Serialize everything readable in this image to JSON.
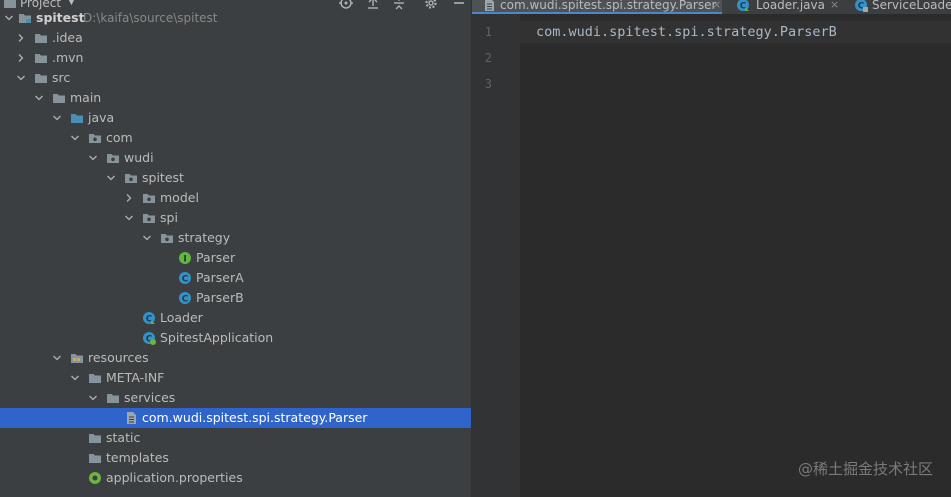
{
  "project_panel": {
    "title": "Project",
    "tree": [
      {
        "label": "spitest",
        "hint": "D:\\kaifa\\source\\spitest",
        "icon": "module-folder-icon",
        "bold": true,
        "expanded": true
      },
      {
        "label": ".idea",
        "icon": "folder-icon",
        "expanded": false
      },
      {
        "label": ".mvn",
        "icon": "folder-icon",
        "expanded": false
      },
      {
        "label": "src",
        "icon": "folder-icon",
        "expanded": true
      },
      {
        "label": "main",
        "icon": "folder-icon",
        "expanded": true
      },
      {
        "label": "java",
        "icon": "source-root-folder-icon",
        "expanded": true
      },
      {
        "label": "com",
        "icon": "package-icon",
        "expanded": true
      },
      {
        "label": "wudi",
        "icon": "package-icon",
        "expanded": true
      },
      {
        "label": "spitest",
        "icon": "package-icon",
        "expanded": true
      },
      {
        "label": "model",
        "icon": "package-icon",
        "expanded": false
      },
      {
        "label": "spi",
        "icon": "package-icon",
        "expanded": true
      },
      {
        "label": "strategy",
        "icon": "package-icon",
        "expanded": true
      },
      {
        "label": "Parser",
        "icon": "interface-icon"
      },
      {
        "label": "ParserA",
        "icon": "class-icon"
      },
      {
        "label": "ParserB",
        "icon": "class-icon"
      },
      {
        "label": "Loader",
        "icon": "class-main-icon"
      },
      {
        "label": "SpitestApplication",
        "icon": "spring-boot-class-icon"
      },
      {
        "label": "resources",
        "icon": "resources-folder-icon",
        "expanded": true
      },
      {
        "label": "META-INF",
        "icon": "folder-icon",
        "expanded": true
      },
      {
        "label": "services",
        "icon": "folder-icon",
        "expanded": true
      },
      {
        "label": "com.wudi.spitest.spi.strategy.Parser",
        "icon": "text-file-icon",
        "selected": true
      },
      {
        "label": "static",
        "icon": "folder-icon"
      },
      {
        "label": "templates",
        "icon": "folder-icon"
      },
      {
        "label": "application.properties",
        "icon": "properties-file-icon"
      }
    ]
  },
  "editor": {
    "tabs": [
      {
        "label": "com.wudi.spitest.spi.strategy.Parser",
        "icon": "text-file-icon",
        "active": true,
        "closable": true,
        "close_label": "×"
      },
      {
        "label": "Loader.java",
        "icon": "class-main-icon",
        "active": false,
        "closable": true,
        "close_label": "×"
      },
      {
        "label": "ServiceLoade",
        "icon": "class-icon",
        "active": false,
        "closable": false
      }
    ],
    "line_numbers": [
      "1",
      "2",
      "3"
    ],
    "code_lines": [
      "com.wudi.spitest.spi.strategy.ParserB",
      "",
      ""
    ]
  },
  "watermark": "@稀土掘金技术社区",
  "colors": {
    "panel_bg": "#3c3f41",
    "editor_bg": "#2b2b2b",
    "selection": "#2f65ca",
    "folder": "#87939a",
    "source_root": "#4a8fb5",
    "class_icon": "#3592c4",
    "interface_icon": "#62b543",
    "code_text": "#a9b7c6"
  }
}
